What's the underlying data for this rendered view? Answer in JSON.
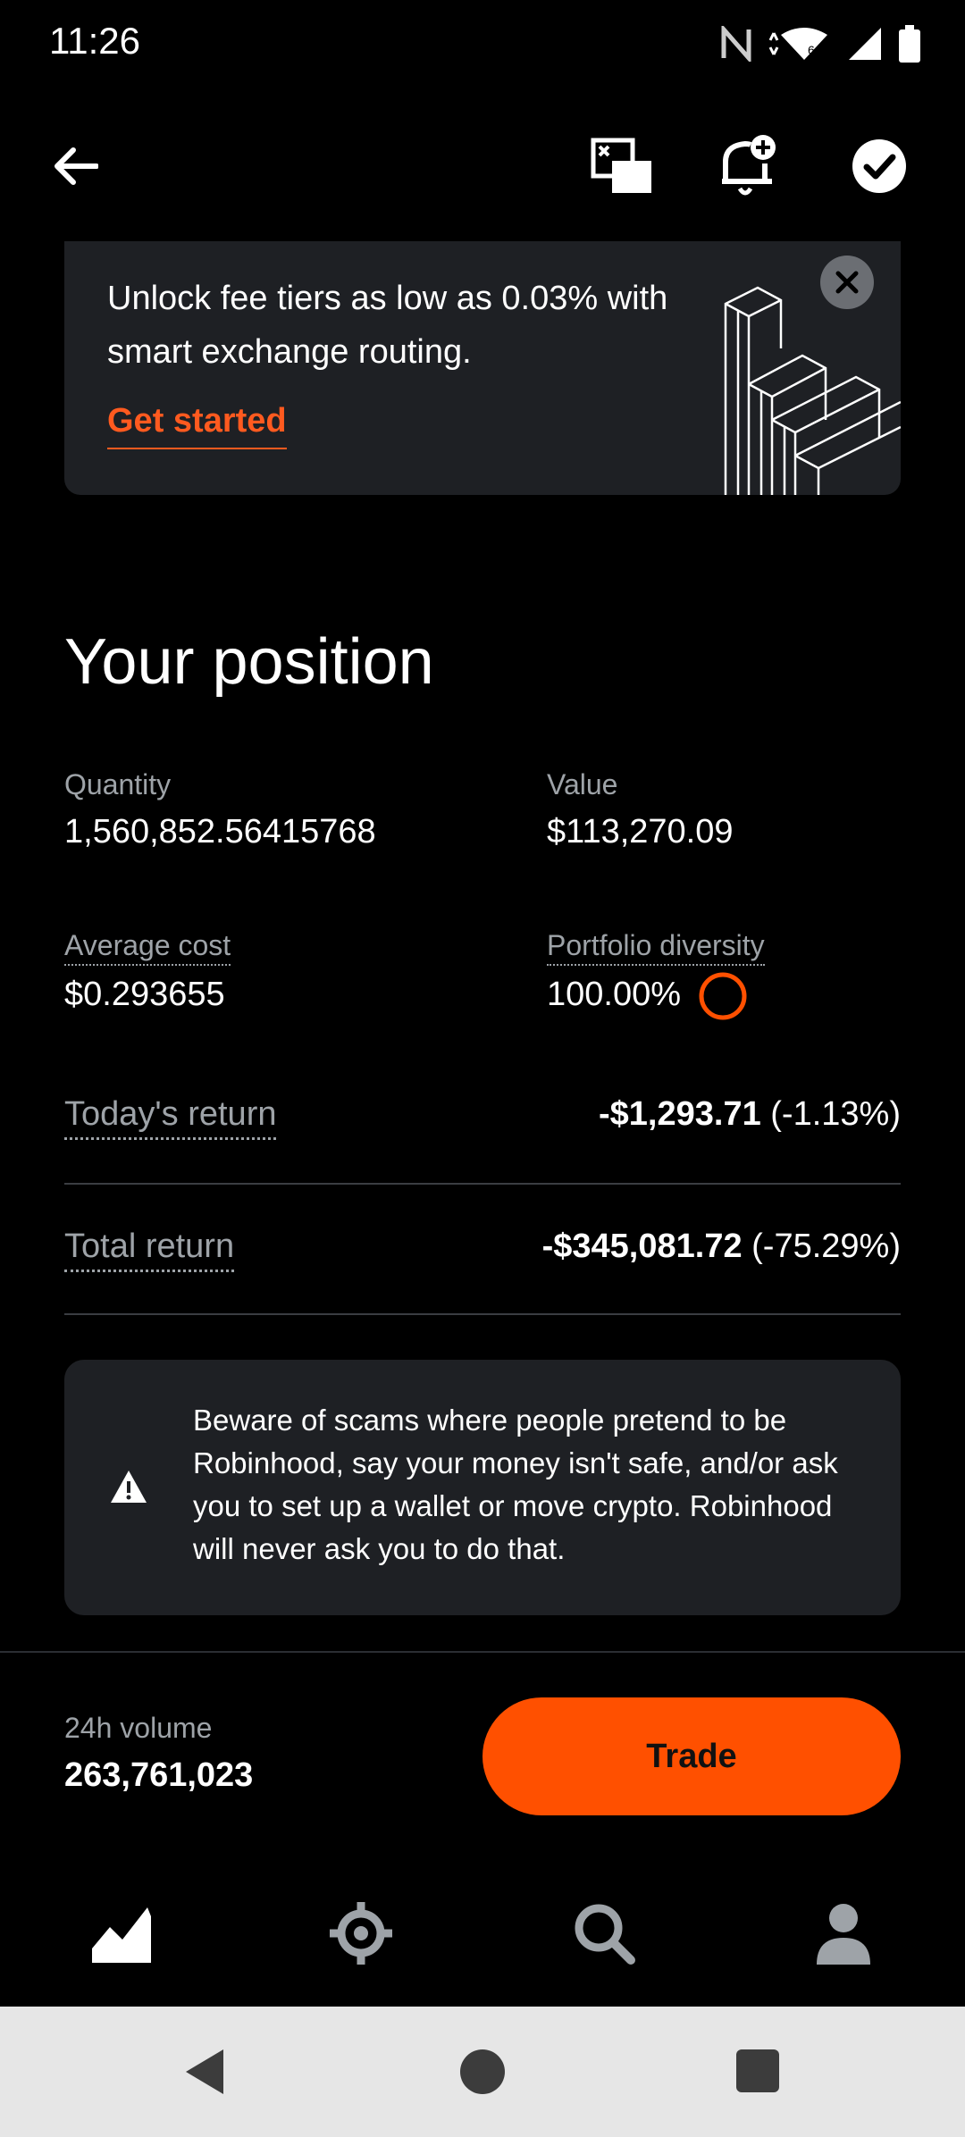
{
  "status_bar": {
    "time": "11:26"
  },
  "top_bar": {
    "icons": [
      "back-arrow-icon",
      "screen-capture-icon",
      "add-alert-bell-icon",
      "check-circle-icon"
    ]
  },
  "promo": {
    "text": "Unlock fee tiers as low as 0.03% with smart exchange routing.",
    "cta": "Get started"
  },
  "position": {
    "title": "Your position",
    "quantity_label": "Quantity",
    "quantity_value": "1,560,852.56415768",
    "value_label": "Value",
    "value_value": "$113,270.09",
    "avg_cost_label": "Average cost",
    "avg_cost_value": "$0.293655",
    "diversity_label": "Portfolio diversity",
    "diversity_value": "100.00%",
    "todays_return_label": "Today's return",
    "todays_return_amount": "-$1,293.71",
    "todays_return_pct": "(-1.13%)",
    "total_return_label": "Total return",
    "total_return_amount": "-$345,081.72",
    "total_return_pct": "(-75.29%)"
  },
  "warning": {
    "text": "Beware of scams where people pretend to be Robinhood, say your money isn't safe, and/or ask you to set up a wallet or move crypto. Robinhood will never ask you to do that."
  },
  "bottom_bar": {
    "volume_label": "24h volume",
    "volume_value": "263,761,023",
    "trade_label": "Trade"
  },
  "colors": {
    "accent": "#ff5000",
    "card": "#1e2024",
    "muted": "#9ea3a8"
  }
}
